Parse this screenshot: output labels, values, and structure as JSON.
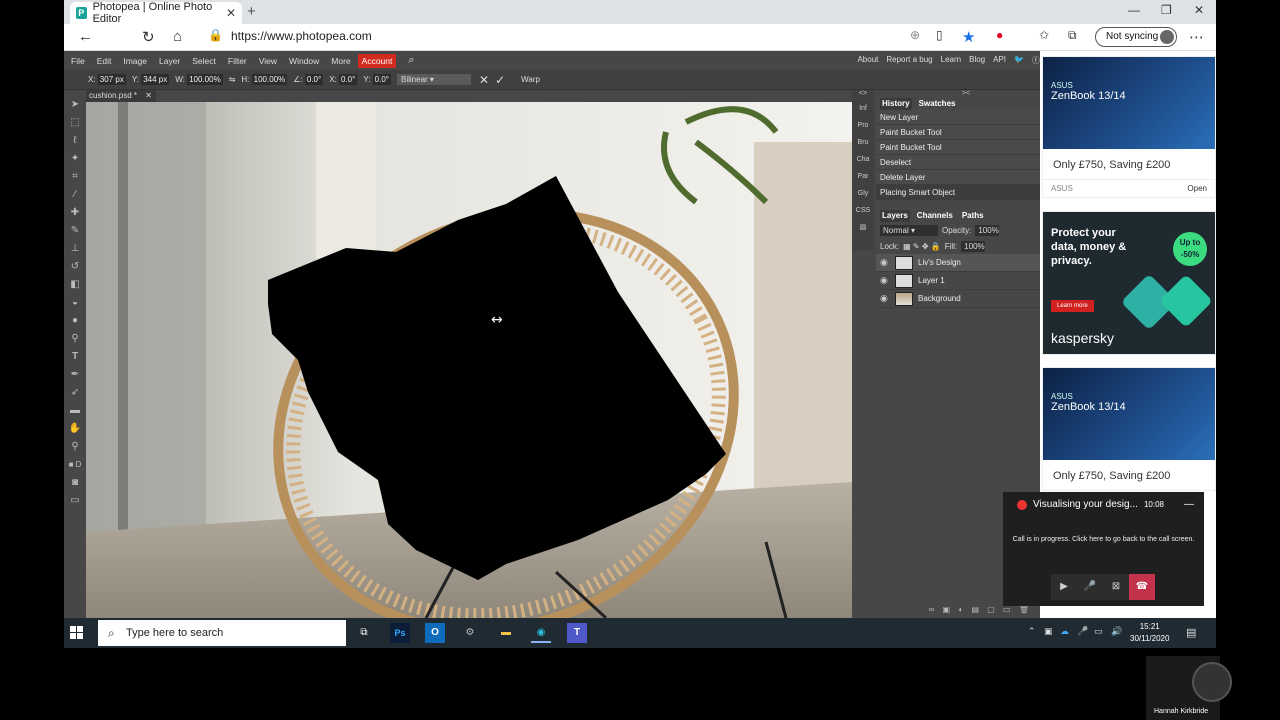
{
  "browser": {
    "tab_title": "Photopea | Online Photo Editor",
    "url": "https://www.photopea.com",
    "sync_label": "Not syncing"
  },
  "menu": {
    "items": [
      "File",
      "Edit",
      "Image",
      "Layer",
      "Select",
      "Filter",
      "View",
      "Window",
      "More"
    ],
    "account": "Account",
    "right": [
      "About",
      "Report a bug",
      "Learn",
      "Blog",
      "API"
    ]
  },
  "options": {
    "x_label": "X:",
    "x": "307 px",
    "y_label": "Y:",
    "y": "344 px",
    "w_label": "W:",
    "w": "100.00%",
    "h_label": "H:",
    "h": "100.00%",
    "angle_label": "∠:",
    "angle": "0.0°",
    "hskew_label": "X:",
    "hskew": "0.0°",
    "vskew_label": "Y:",
    "vskew": "0.0°",
    "interpolation": "Bilinear",
    "warp": "Warp"
  },
  "document": {
    "tab": "cushion.psd *"
  },
  "panel_strip": [
    "Inf",
    "Pro",
    "Bru",
    "Cha",
    "Par",
    "Gly",
    "CSS"
  ],
  "history": {
    "tabs": [
      "History",
      "Swatches"
    ],
    "items": [
      "New Layer",
      "Paint Bucket Tool",
      "Paint Bucket Tool",
      "Deselect",
      "Delete Layer",
      "Placing Smart Object"
    ]
  },
  "layers": {
    "tabs": [
      "Layers",
      "Channels",
      "Paths"
    ],
    "blend_mode": "Normal",
    "opacity_label": "Opacity:",
    "opacity": "100%",
    "lock_label": "Lock:",
    "fill_label": "Fill:",
    "fill": "100%",
    "items": [
      {
        "name": "Liv's Design",
        "selected": true
      },
      {
        "name": "Layer 1",
        "selected": false
      },
      {
        "name": "Background",
        "selected": false
      }
    ]
  },
  "ads": {
    "asus1": {
      "brand": "ASUS",
      "product": "ZenBook 13/14",
      "price": "Only £750, Saving £200",
      "footer_brand": "ASUS",
      "cta": "Open"
    },
    "kaspersky": {
      "headline": "Protect your data, money & privacy.",
      "badge_top": "Up to",
      "badge": "-50%",
      "button": "Learn more",
      "logo": "kaspersky"
    },
    "asus2": {
      "brand": "ASUS",
      "product": "ZenBook 13/14",
      "price": "Only £750, Saving £200"
    }
  },
  "teams": {
    "title": "Visualising your desig...",
    "time": "10:08",
    "message": "Call is in progress. Click here to go back to the call screen."
  },
  "taskbar": {
    "search_placeholder": "Type here to search",
    "time": "15:21",
    "date": "30/11/2020"
  },
  "webcam": {
    "name": "Hannah Kirkbride"
  },
  "colors": {
    "accent_red": "#d12b1f",
    "teams_end": "#c4314b",
    "photopea_bg": "#474747"
  }
}
